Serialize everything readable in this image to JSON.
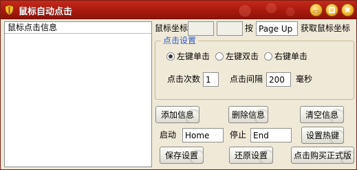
{
  "window": {
    "title": "鼠标自动点击"
  },
  "list": {
    "header": "鼠标点击信息",
    "items": []
  },
  "coords": {
    "label": "鼠标坐标",
    "x": "",
    "y": "",
    "press_label": "按",
    "hotkey": "Page Up",
    "suffix": "获取鼠标坐标"
  },
  "click_settings": {
    "title": "点击设置",
    "modes": [
      {
        "label": "左键单击",
        "checked": true
      },
      {
        "label": "左键双击",
        "checked": false
      },
      {
        "label": "右键单击",
        "checked": false
      }
    ],
    "count_label": "点击次数",
    "count": "1",
    "interval_label": "点击间隔",
    "interval": "200",
    "unit": "毫秒"
  },
  "buttons": {
    "add": "添加信息",
    "delete": "删除信息",
    "clear": "清空信息",
    "set_hotkey": "设置热键",
    "save": "保存设置",
    "restore": "还原设置",
    "buy": "点击购买正式版"
  },
  "hotkeys": {
    "start_label": "启动",
    "start": "Home",
    "stop_label": "停止",
    "stop": "End"
  }
}
